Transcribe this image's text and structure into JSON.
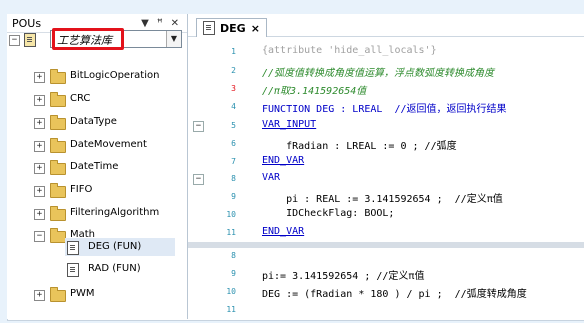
{
  "pous": {
    "title": "POUs",
    "header_icons": [
      "chevron-down-icon",
      "pin-icon",
      "close-icon"
    ],
    "root": {
      "expander": "⊟",
      "name": "工艺算法库"
    },
    "items": [
      {
        "label": "BitLogicOperation",
        "expander": "+"
      },
      {
        "label": "CRC",
        "expander": "+"
      },
      {
        "label": "DataType",
        "expander": "+"
      },
      {
        "label": "DateMovement",
        "expander": "+"
      },
      {
        "label": "DateTime",
        "expander": "+"
      },
      {
        "label": "FIFO",
        "expander": "+"
      },
      {
        "label": "FilteringAlgorithm",
        "expander": "+"
      },
      {
        "label": "Math",
        "expander": "−"
      },
      {
        "label": "DEG (FUN)",
        "expander": ""
      },
      {
        "label": "RAD (FUN)",
        "expander": ""
      },
      {
        "label": "PWM",
        "expander": "+"
      }
    ]
  },
  "editor": {
    "tab_title": "DEG",
    "tab_close": "×",
    "top_lines": [
      {
        "n": "1",
        "text": "{attribute 'hide_all_locals'}"
      },
      {
        "n": "2",
        "text": "//弧度值转换成角度值运算，浮点数弧度转换成角度"
      },
      {
        "n": "3",
        "text": "//π取3.141592654值"
      },
      {
        "n": "4",
        "text": "FUNCTION DEG : LREAL  //返回值，返回执行结果"
      },
      {
        "n": "5",
        "text": "VAR_INPUT"
      },
      {
        "n": "6",
        "text": "    fRadian : LREAL := 0 ; //弧度"
      },
      {
        "n": "7",
        "text": "END_VAR"
      },
      {
        "n": "8",
        "text": "VAR"
      },
      {
        "n": "9",
        "text": "    pi : REAL := 3.141592654 ;  //定义π值"
      },
      {
        "n": "10",
        "text": "    IDCheckFlag: BOOL;"
      },
      {
        "n": "11",
        "text": "END_VAR"
      }
    ],
    "bottom_lines": [
      {
        "n": "8",
        "text": ""
      },
      {
        "n": "9",
        "text": "pi:= 3.141592654 ; //定义π值"
      },
      {
        "n": "10",
        "text": "DEG := (fRadian * 180 ) / pi ;  //弧度转成角度"
      },
      {
        "n": "11",
        "text": ""
      }
    ]
  }
}
